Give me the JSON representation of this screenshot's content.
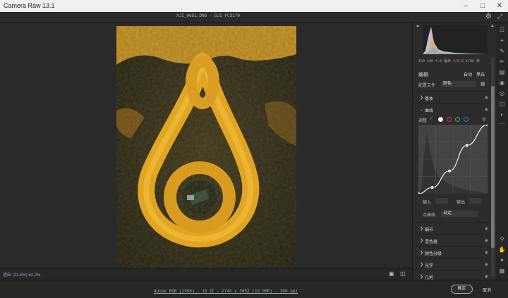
{
  "app": {
    "title": "Camera Raw 13.1"
  },
  "file_info": "XJI_0651.DNG - DJI FC3170",
  "status": {
    "zoom": "适应 (21.5%)   62.2%"
  },
  "workflow": "Adobe RGB (1998) - 16 位 - 2740 x 3652 (10.0MP) - 300 ppi",
  "buttons": {
    "ok": "确定",
    "cancel": "取消"
  },
  "exif": "ISO 100   4.5 毫米   f/2.8   1/80 秒",
  "edit": {
    "title": "编辑",
    "auto": "自动",
    "bw": "黑白",
    "profile_label": "配置文件",
    "profile_value": "颜色"
  },
  "sections": {
    "basic": "基本",
    "curve": "曲线",
    "detail": "细节",
    "mixer": "混色器",
    "grading": "颜色分级",
    "optics": "光学",
    "geometry": "几何"
  },
  "curve": {
    "adjust_label": "调整",
    "input_label": "输入",
    "output_label": "输出",
    "point_curve_label": "点曲线",
    "point_curve_value": "自定",
    "points": [
      [
        0.0,
        0.0
      ],
      [
        0.2,
        0.09
      ],
      [
        0.45,
        0.33
      ],
      [
        0.7,
        0.7
      ],
      [
        1.0,
        1.0
      ]
    ]
  },
  "colors": {
    "accent": "#9ab0d8",
    "panel_bg": "#2c2c2c",
    "red": "#d23b3b",
    "green": "#3bb04a",
    "blue": "#3b6ed2"
  }
}
